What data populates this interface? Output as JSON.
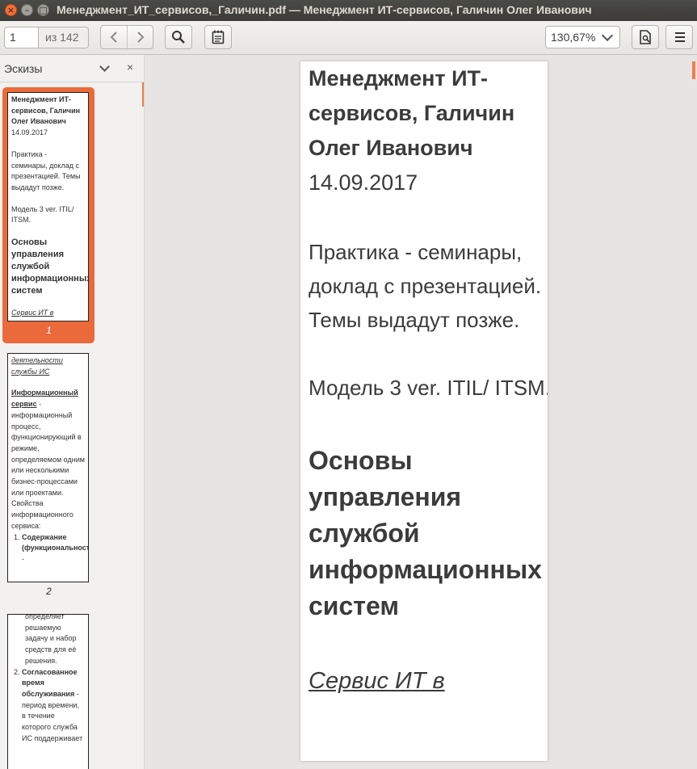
{
  "window": {
    "title": "Менеджмент_ИТ_сервисов,_Галичин.pdf — Менеджмент ИТ-сервисов, Галичин Олег Иванович"
  },
  "toolbar": {
    "page_number": "1",
    "page_count": "из 142",
    "zoom": "130,67%"
  },
  "sidebar": {
    "title": "Эскизы",
    "thumbnails": [
      {
        "number": "1",
        "title": "Менеджмент ИТ-сервисов, Галичин Олег Иванович",
        "date": "14.09.2017",
        "practice": "Практика - семинары, доклад с презентацией. Темы выдадут позже.",
        "model": "Модель 3 ver. ITIL/ ITSM.",
        "heading": "Основы управления службой информационных систем",
        "link": "Сервис ИТ в"
      },
      {
        "number": "2",
        "link": "деятельности службы ИС",
        "term": "Информационный сервис",
        "definition": " - информационный процесс, функционирующий в режиме, определяемом одним или несколькими бизнес-процессами или проектами.",
        "props": "Свойства информационного сервиса:",
        "list_item": "Содержание (функциональность)",
        "list_item_tail": " -"
      },
      {
        "continuation": "определяет решаемую задачу и набор средств для её решения.",
        "list_item": "Согласованное время обслуживания",
        "list_item_tail": " - период времени, в течение которого служба ИС поддерживает"
      }
    ]
  },
  "document": {
    "title": "Менеджмент ИТ-сервисов, Галичин Олег Иванович",
    "date": "14.09.2017",
    "practice": "Практика - семинары, доклад с презентацией. Темы выдадут позже.",
    "model": "Модель 3 ver. ITIL/ ITSM.",
    "heading": "Основы управления службой информационных систем",
    "link": "Сервис ИТ в"
  }
}
